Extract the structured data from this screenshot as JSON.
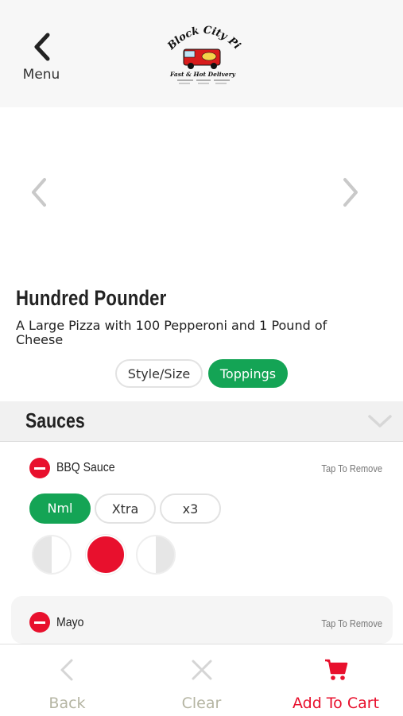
{
  "header": {
    "back_label": "Menu",
    "logo": {
      "name": "Block City Pizza",
      "tagline": "Fast & Hot Delivery"
    }
  },
  "product": {
    "title": "Hundred Pounder",
    "description": "A Large Pizza with 100 Pepperoni and 1 Pound of Cheese"
  },
  "tabs": [
    {
      "label": "Style/Size",
      "active": false
    },
    {
      "label": "Toppings",
      "active": true
    }
  ],
  "section": {
    "title": "Sauces"
  },
  "items": [
    {
      "name": "BBQ Sauce",
      "action_hint": "Tap To Remove",
      "amounts": [
        "Nml",
        "Xtra",
        "x3"
      ],
      "selected_amount": "Nml",
      "portions": [
        "left-half",
        "whole",
        "right-half"
      ],
      "selected_portion": "whole"
    },
    {
      "name": "Mayo",
      "action_hint": "Tap To Remove"
    }
  ],
  "footer": {
    "back": "Back",
    "clear": "Clear",
    "add_to_cart": "Add To Cart"
  },
  "colors": {
    "accent_green": "#14a455",
    "accent_red": "#e8102d",
    "muted": "#b5b5a3"
  }
}
